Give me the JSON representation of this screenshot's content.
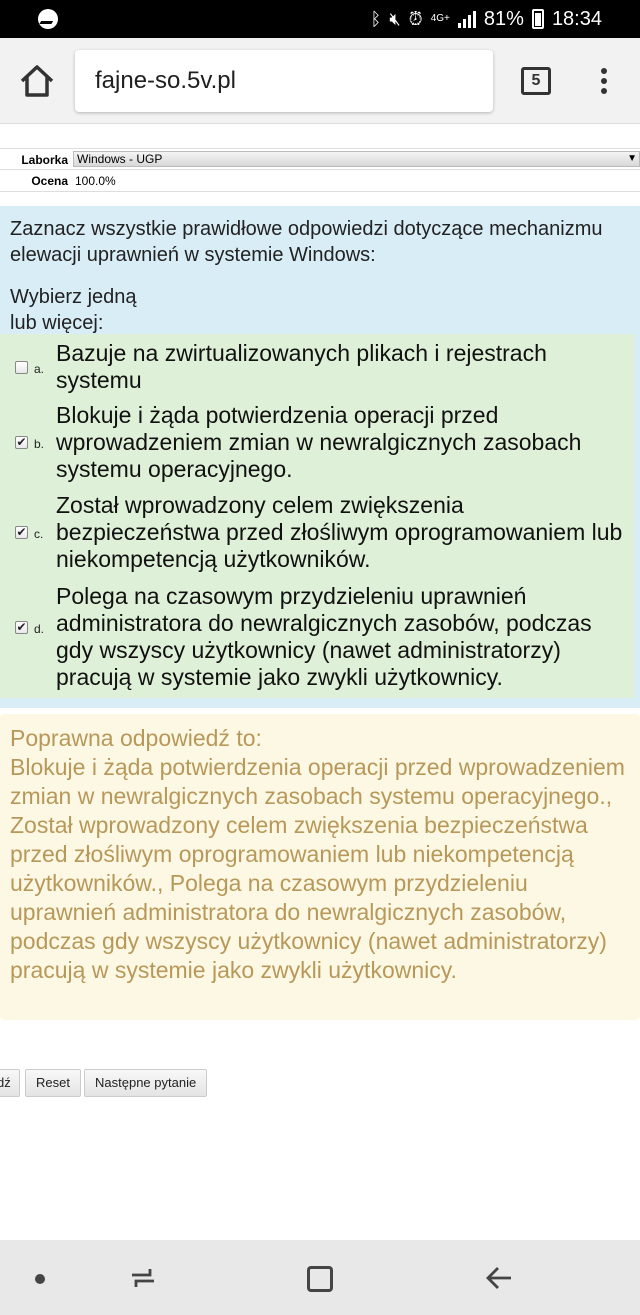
{
  "status_bar": {
    "network": "4G+",
    "battery_percent": "81%",
    "time": "18:34",
    "icons": [
      "messenger-icon",
      "bluetooth-icon",
      "mute-icon",
      "alarm-icon",
      "signal-icon",
      "battery-icon"
    ]
  },
  "browser": {
    "url": "fajne-so.5v.pl",
    "tab_count": "5",
    "icons": [
      "home-icon",
      "tabs-icon",
      "menu-icon"
    ]
  },
  "info": {
    "lab_label": "Laborka",
    "lab_value": "Windows - UGP",
    "grade_label": "Ocena",
    "grade_value": "100.0%"
  },
  "question": {
    "text": "Zaznacz wszystkie prawidłowe odpowiedzi dotyczące mechanizmu elewacji uprawnień w systemie Windows:",
    "hint": "Wybierz jedną lub więcej:",
    "answers": [
      {
        "letter": "a.",
        "checked": false,
        "text": "Bazuje na zwirtualizowanych plikach i rejestrach systemu"
      },
      {
        "letter": "b.",
        "checked": true,
        "text": "Blokuje i żąda potwierdzenia operacji przed wprowadzeniem zmian w newralgicznych zasobach systemu operacyjnego."
      },
      {
        "letter": "c.",
        "checked": true,
        "text": "Został wprowadzony celem zwiększenia bezpieczeństwa przed złośliwym oprogramowaniem lub niekompetencją użytkowników."
      },
      {
        "letter": "d.",
        "checked": true,
        "text": "Polega na czasowym przydzieleniu uprawnień administratora do newralgicznych zasobów, podczas gdy wszyscy użytkownicy (nawet administratorzy) pracują w systemie jako zwykli użytkownicy."
      }
    ]
  },
  "feedback": {
    "intro": "Poprawna odpowiedź to:",
    "text": "Blokuje i żąda potwierdzenia operacji przed wprowadzeniem zmian w newralgicznych zasobach systemu operacyjnego., Został wprowadzony celem zwiększenia bezpieczeństwa przed złośliwym oprogramowaniem lub niekompetencją użytkowników., Polega na czasowym przydzieleniu uprawnień administratora do newralgicznych zasobów, podczas gdy wszyscy użytkownicy (nawet administratorzy) pracują w systemie jako zwykli użytkownicy."
  },
  "buttons": {
    "partial": "dź",
    "reset": "Reset",
    "next": "Następne pytanie"
  },
  "nav_bar": {
    "icons": [
      "dot-icon",
      "recent-apps-icon",
      "home-square-icon",
      "back-arrow-icon"
    ]
  }
}
